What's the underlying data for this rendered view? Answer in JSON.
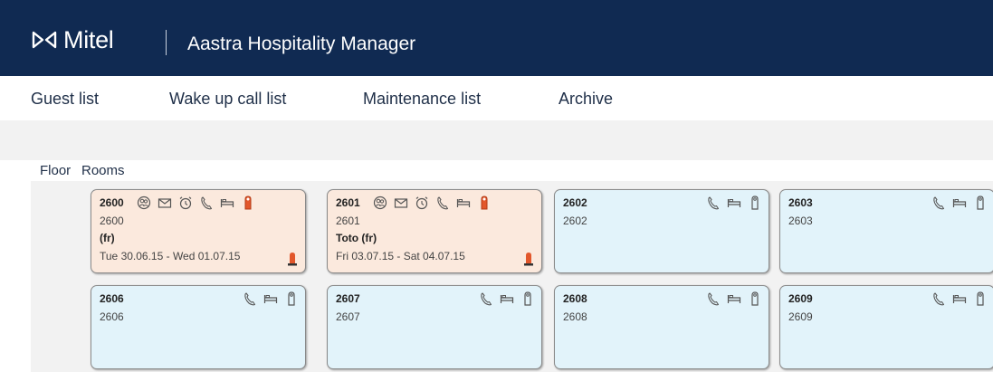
{
  "header": {
    "brand": "Mitel",
    "app_title": "Aastra Hospitality Manager",
    "background": "#102a52"
  },
  "nav": [
    {
      "label": "Guest list"
    },
    {
      "label": "Wake up call list"
    },
    {
      "label": "Maintenance list"
    },
    {
      "label": "Archive"
    }
  ],
  "columns": {
    "floor": "Floor",
    "rooms": "Rooms"
  },
  "rooms": [
    {
      "number": "2600",
      "name": "2600",
      "guest": "(fr)",
      "dates": "Tue 30.06.15 - Wed 01.07.15",
      "status": "occupied",
      "icons": [
        "guest-group-icon",
        "message-icon",
        "alarm-clock-icon",
        "phone-icon",
        "bed-icon",
        "door-hanger-icon"
      ]
    },
    {
      "number": "2601",
      "name": "2601",
      "guest": "Toto (fr)",
      "dates": "Fri 03.07.15 - Sat 04.07.15",
      "status": "occupied",
      "icons": [
        "guest-group-icon",
        "message-icon",
        "alarm-clock-icon",
        "phone-icon",
        "bed-icon",
        "door-hanger-icon"
      ]
    },
    {
      "number": "2602",
      "name": "2602",
      "status": "free",
      "icons": [
        "phone-icon",
        "bed-icon",
        "door-hanger-icon"
      ]
    },
    {
      "number": "2603",
      "name": "2603",
      "status": "free",
      "icons": [
        "phone-icon",
        "bed-icon",
        "door-hanger-icon"
      ]
    },
    {
      "number": "2606",
      "name": "2606",
      "status": "free",
      "icons": [
        "phone-icon",
        "bed-icon",
        "door-hanger-icon"
      ]
    },
    {
      "number": "2607",
      "name": "2607",
      "status": "free",
      "icons": [
        "phone-icon",
        "bed-icon",
        "door-hanger-icon"
      ]
    },
    {
      "number": "2608",
      "name": "2608",
      "status": "free",
      "icons": [
        "phone-icon",
        "bed-icon",
        "door-hanger-icon"
      ]
    },
    {
      "number": "2609",
      "name": "2609",
      "status": "free",
      "icons": [
        "phone-icon",
        "bed-icon",
        "door-hanger-icon"
      ]
    }
  ],
  "colors": {
    "occupied_card": "#fbe9dd",
    "free_card": "#e2f3fa",
    "alert": "#e2572b"
  }
}
